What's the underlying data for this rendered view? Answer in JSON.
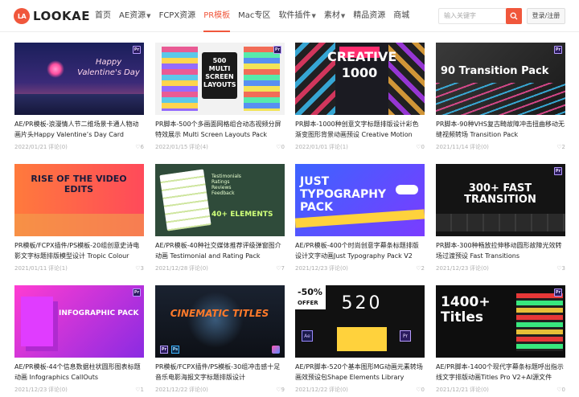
{
  "header": {
    "logo_mark": "LA",
    "logo_text": "LOOKAE",
    "nav": [
      {
        "label": "首页",
        "active": false,
        "dropdown": false
      },
      {
        "label": "AE资源",
        "active": false,
        "dropdown": true
      },
      {
        "label": "FCPX资源",
        "active": false,
        "dropdown": false
      },
      {
        "label": "PR模板",
        "active": true,
        "dropdown": false
      },
      {
        "label": "Mac专区",
        "active": false,
        "dropdown": false
      },
      {
        "label": "软件插件",
        "active": false,
        "dropdown": true
      },
      {
        "label": "素材",
        "active": false,
        "dropdown": true
      },
      {
        "label": "精品资源",
        "active": false,
        "dropdown": false
      },
      {
        "label": "商城",
        "active": false,
        "dropdown": false
      }
    ],
    "search_placeholder": "输入关键字",
    "login_label": "登录/注册"
  },
  "cards": [
    {
      "title": "AE/PR模板-浪漫情人节二维场景卡通人物动画片头Happy Valentine’s Day Card",
      "date": "2022/01/21",
      "comments": "评论(0)",
      "likes": "6",
      "thumb_text": "Happy Valentine's Day"
    },
    {
      "title": "PR脚本-500个多画面网格组合动态视频分屏特效展示 Multi Screen Layouts Pack",
      "date": "2022/01/15",
      "comments": "评论(4)",
      "likes": "0",
      "thumb_text": "500 MULTI SCREEN LAYOUTS"
    },
    {
      "title": "PR脚本-1000种创意文字标题排版设计彩色渐变图形背景动画预设 Creative Motion",
      "date": "2022/01/01",
      "comments": "评论(1)",
      "likes": "0",
      "thumb_text": "CREATIVE 1000"
    },
    {
      "title": "PR脚本-90种VHS复古畸故障冲击扭曲移动无缝视频转场 Transition Pack",
      "date": "2021/11/14",
      "comments": "评论(0)",
      "likes": "2",
      "thumb_text": "90 Transition Pack"
    },
    {
      "title": "PR模板/FCPX插件/PS模板-20组创意史诗电影文字标题排版模型设计 Tropic Colour",
      "date": "2021/01/11",
      "comments": "评论(1)",
      "likes": "3",
      "thumb_text": "RISE OF THE VIDEO EDITS"
    },
    {
      "title": "AE/PR模板-40种社交媒体推荐评级弹窗图介动画 Testimonial and Rating Pack",
      "date": "2021/12/28",
      "comments": "评论(0)",
      "likes": "7",
      "thumb_text": "40+ ELEMENTS"
    },
    {
      "title": "AE/PR模板-400个时尚创意字幕条标题排版设计文字动画Just Typography Pack V2",
      "date": "2021/12/23",
      "comments": "评论(0)",
      "likes": "2",
      "thumb_text": "JUST TYPOGRAPHY PACK"
    },
    {
      "title": "PR脚本-300种畅放拉伸移动圆形故障光效转场过渡预设 Fast Transitions",
      "date": "2021/12/23",
      "comments": "评论(0)",
      "likes": "3",
      "thumb_text": "300+ FAST TRANSITION"
    },
    {
      "title": "AE/PR模板-44个信息数据柱状圆形图表标题动画 Infographics CallOuts",
      "date": "2021/12/23",
      "comments": "评论(0)",
      "likes": "1",
      "thumb_text": "INFOGRAPHIC PACK"
    },
    {
      "title": "PR模板/FCPX插件/PS模板-30组冲击感十足音乐电影海报文字标题排版设计",
      "date": "2021/12/22",
      "comments": "评论(0)",
      "likes": "9",
      "thumb_text": "CINEMATIC TITLES"
    },
    {
      "title": "AE/PR脚本-520个基本图形MG动画元素转场画效预设包Shape Elements Library",
      "date": "2021/12/22",
      "comments": "评论(0)",
      "likes": "0",
      "thumb_text": "520"
    },
    {
      "title": "AE/PR脚本-1400个现代字幕条标题呼出指示线文字排版动画Titles Pro V2+AI源文件",
      "date": "2021/12/21",
      "comments": "评论(0)",
      "likes": "0",
      "thumb_text": "1400+ Titles"
    }
  ],
  "colors": {
    "accent": "#f0573c"
  }
}
